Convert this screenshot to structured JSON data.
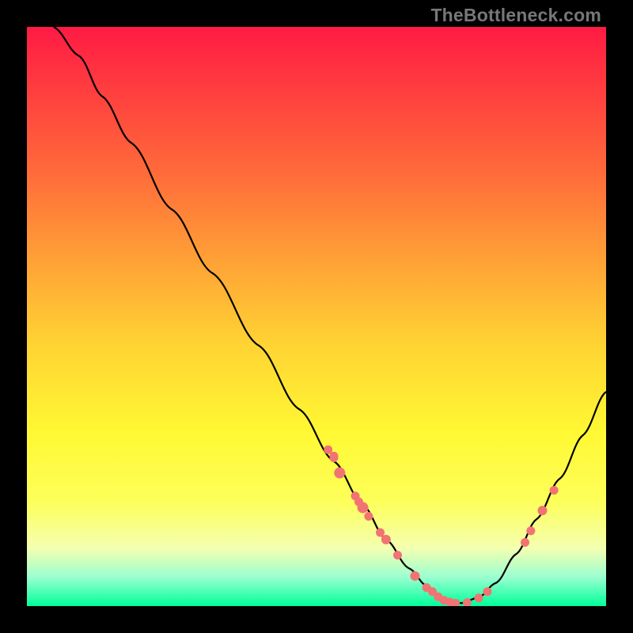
{
  "watermark": "TheBottleneck.com",
  "chart_data": {
    "type": "line",
    "title": "",
    "xlabel": "",
    "ylabel": "",
    "xlim": [
      0,
      100
    ],
    "ylim": [
      0,
      100
    ],
    "curve": [
      {
        "x": 4.6,
        "y": 100.0
      },
      {
        "x": 9.0,
        "y": 95.0
      },
      {
        "x": 13.0,
        "y": 88.0
      },
      {
        "x": 18.0,
        "y": 80.0
      },
      {
        "x": 25.0,
        "y": 68.5
      },
      {
        "x": 32.0,
        "y": 57.5
      },
      {
        "x": 40.0,
        "y": 45.0
      },
      {
        "x": 47.0,
        "y": 34.0
      },
      {
        "x": 53.0,
        "y": 25.0
      },
      {
        "x": 58.0,
        "y": 17.5
      },
      {
        "x": 62.0,
        "y": 11.5
      },
      {
        "x": 66.0,
        "y": 6.5
      },
      {
        "x": 69.0,
        "y": 3.5
      },
      {
        "x": 72.0,
        "y": 1.2
      },
      {
        "x": 75.0,
        "y": 0.5
      },
      {
        "x": 78.0,
        "y": 1.5
      },
      {
        "x": 81.0,
        "y": 4.0
      },
      {
        "x": 84.5,
        "y": 9.0
      },
      {
        "x": 88.0,
        "y": 15.0
      },
      {
        "x": 92.0,
        "y": 22.0
      },
      {
        "x": 96.0,
        "y": 29.5
      },
      {
        "x": 100.0,
        "y": 37.0
      }
    ],
    "markers": [
      {
        "x": 52.0,
        "y": 27.0,
        "r": 5.5
      },
      {
        "x": 53.0,
        "y": 25.9,
        "r": 5.5
      },
      {
        "x": 53.0,
        "y": 25.6,
        "r": 5.5
      },
      {
        "x": 54.0,
        "y": 23.0,
        "r": 7.0
      },
      {
        "x": 56.7,
        "y": 19.0,
        "r": 5.5
      },
      {
        "x": 57.3,
        "y": 18.0,
        "r": 5.5
      },
      {
        "x": 58.0,
        "y": 17.0,
        "r": 7.0
      },
      {
        "x": 59.0,
        "y": 15.5,
        "r": 5.5
      },
      {
        "x": 61.0,
        "y": 12.7,
        "r": 5.5
      },
      {
        "x": 62.0,
        "y": 11.5,
        "r": 6.0
      },
      {
        "x": 64.0,
        "y": 8.8,
        "r": 5.5
      },
      {
        "x": 67.0,
        "y": 5.2,
        "r": 6.0
      },
      {
        "x": 69.0,
        "y": 3.2,
        "r": 5.5
      },
      {
        "x": 70.0,
        "y": 2.5,
        "r": 5.5
      },
      {
        "x": 71.0,
        "y": 1.6,
        "r": 5.5
      },
      {
        "x": 72.0,
        "y": 1.0,
        "r": 5.5
      },
      {
        "x": 73.0,
        "y": 0.7,
        "r": 5.5
      },
      {
        "x": 74.0,
        "y": 0.5,
        "r": 5.5
      },
      {
        "x": 76.0,
        "y": 0.6,
        "r": 5.5
      },
      {
        "x": 78.0,
        "y": 1.4,
        "r": 5.5
      },
      {
        "x": 79.5,
        "y": 2.5,
        "r": 5.5
      },
      {
        "x": 86.0,
        "y": 11.0,
        "r": 5.5
      },
      {
        "x": 87.0,
        "y": 13.0,
        "r": 5.5
      },
      {
        "x": 89.0,
        "y": 16.5,
        "r": 6.0
      },
      {
        "x": 91.0,
        "y": 20.0,
        "r": 5.5
      }
    ],
    "marker_color": "#f27373",
    "curve_color": "#000000"
  }
}
